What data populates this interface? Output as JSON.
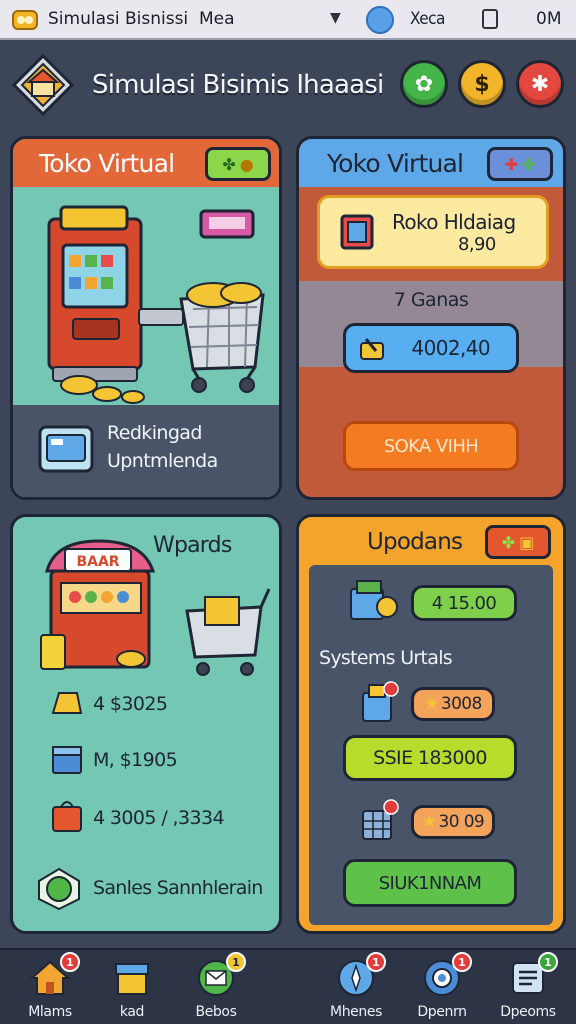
{
  "statusbar": {
    "title": "Simulasi Bisnissi",
    "title2": "Mea",
    "search": "Xeca",
    "right": "0M"
  },
  "header": {
    "title": "Simulasi Bisimis Ihaaasi"
  },
  "panel_store": {
    "title": "Toko Virtual",
    "info_line1": "Redkingad",
    "info_line2": "Upntmlenda"
  },
  "panel_detail": {
    "title": "Yoko Virtual",
    "card_title": "Roko Hldaiag",
    "card_value": "8,90",
    "subtitle": "7 Ganas",
    "price": "4002,40",
    "action": "SOKA VIHH"
  },
  "panel_rewards": {
    "title": "Wpards",
    "items": [
      {
        "value": "4 $3025"
      },
      {
        "value": "M, $1905"
      },
      {
        "value": "4 3005 / ,3334"
      }
    ],
    "footer": "Sanles Sannhlerain",
    "stand_sign": "BAAR"
  },
  "panel_updates": {
    "title": "Upodans",
    "top_value": "4 15.00",
    "systems_label": "Systems Urtals",
    "row1_value": "3008",
    "big_value": "SSIE 183000",
    "row2_value": "30 09",
    "action": "SIUK1NNAM"
  },
  "bottomnav": {
    "items": [
      {
        "label": "Mlams",
        "badge": "1"
      },
      {
        "label": "kad",
        "badge": ""
      },
      {
        "label": "Bebos",
        "badge": "1"
      },
      {
        "label": "Mhenes",
        "badge": "1"
      },
      {
        "label": "Dpenrn",
        "badge": "1"
      },
      {
        "label": "Dpeoms",
        "badge": "1"
      }
    ]
  },
  "colors": {
    "bg": "#3c4658",
    "panel_orange": "#e2683a",
    "panel_blue": "#5fa8e8",
    "panel_teal": "#74c7b3",
    "panel_yellow": "#f4a42a"
  }
}
